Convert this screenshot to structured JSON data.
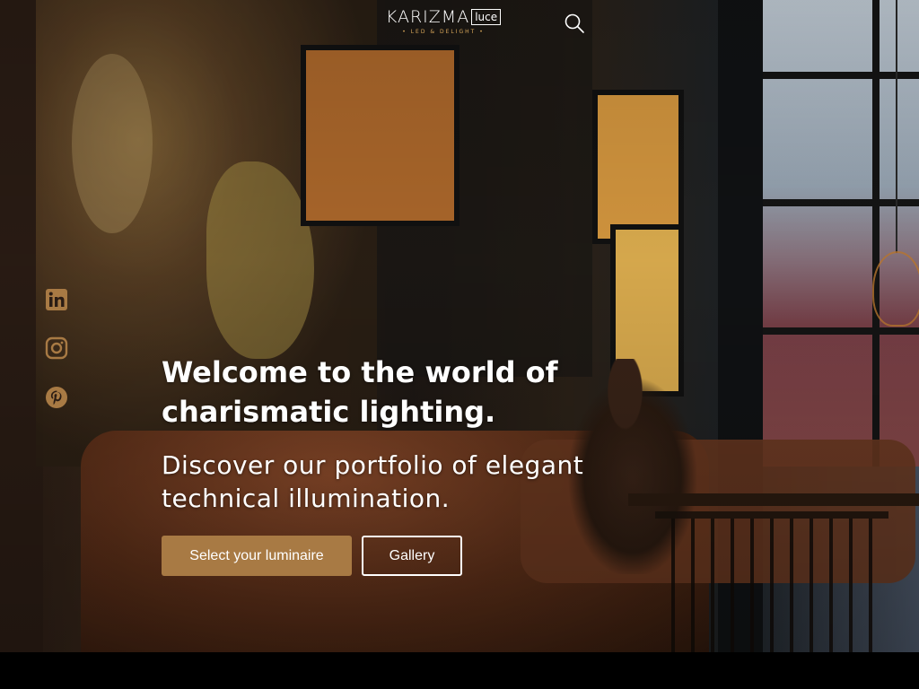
{
  "brand": {
    "name": "KARIZMA",
    "badge": "luce",
    "tagline": "• LED & DELIGHT •",
    "accent_color": "#a87a44"
  },
  "header": {
    "search_icon": "search-icon"
  },
  "social_links": [
    {
      "name": "LinkedIn",
      "icon": "linkedin-icon"
    },
    {
      "name": "Instagram",
      "icon": "instagram-icon"
    },
    {
      "name": "Pinterest",
      "icon": "pinterest-icon"
    }
  ],
  "hero": {
    "headline": "Welcome to the world of charismatic lighting.",
    "subline": "Discover our portfolio of elegant technical illumination.",
    "primary_button": "Select your luminaire",
    "secondary_button": "Gallery"
  }
}
